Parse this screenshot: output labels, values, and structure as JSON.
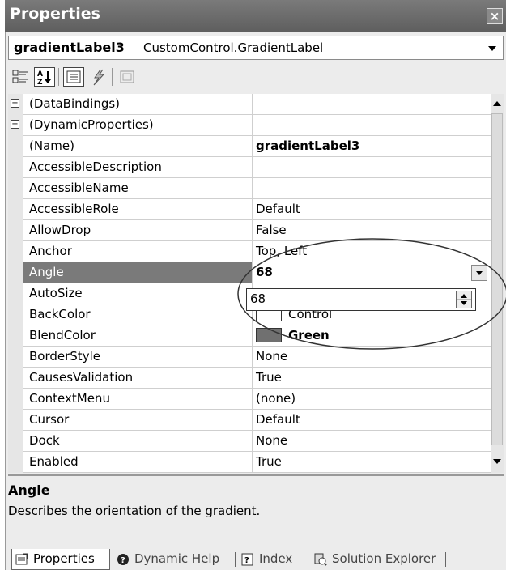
{
  "window": {
    "title": "Properties",
    "close_symbol": "×"
  },
  "object_selector": {
    "name": "gradientLabel3",
    "type": "CustomControl.GradientLabel"
  },
  "toolbar": {
    "buttons": [
      {
        "name": "categorized-icon"
      },
      {
        "name": "alphabetical-icon"
      },
      {
        "name": "properties-icon"
      },
      {
        "name": "events-icon"
      },
      {
        "name": "property-pages-icon"
      }
    ]
  },
  "properties": [
    {
      "name": "(DataBindings)",
      "value": "",
      "expandable": true
    },
    {
      "name": "(DynamicProperties)",
      "value": "",
      "expandable": true
    },
    {
      "name": "(Name)",
      "value": "gradientLabel3",
      "bold_value": true
    },
    {
      "name": "AccessibleDescription",
      "value": ""
    },
    {
      "name": "AccessibleName",
      "value": ""
    },
    {
      "name": "AccessibleRole",
      "value": "Default"
    },
    {
      "name": "AllowDrop",
      "value": "False"
    },
    {
      "name": "Anchor",
      "value": "Top, Left"
    },
    {
      "name": "Angle",
      "value": "68",
      "selected": true,
      "bold_value": true
    },
    {
      "name": "AutoSize",
      "value": ""
    },
    {
      "name": "BackColor",
      "value": "Control",
      "swatch": "#ffffff"
    },
    {
      "name": "BlendColor",
      "value": "Green",
      "swatch": "#707070",
      "bold_value": true
    },
    {
      "name": "BorderStyle",
      "value": "None"
    },
    {
      "name": "CausesValidation",
      "value": "True"
    },
    {
      "name": "ContextMenu",
      "value": "(none)"
    },
    {
      "name": "Cursor",
      "value": "Default"
    },
    {
      "name": "Dock",
      "value": "None"
    },
    {
      "name": "Enabled",
      "value": "True"
    }
  ],
  "angle_editor": {
    "value": "68"
  },
  "description": {
    "title": "Angle",
    "text": "Describes the orientation of the gradient."
  },
  "tabs": [
    {
      "label": "Properties",
      "active": true
    },
    {
      "label": "Dynamic Help"
    },
    {
      "label": "Index"
    },
    {
      "label": "Solution Explorer"
    }
  ]
}
